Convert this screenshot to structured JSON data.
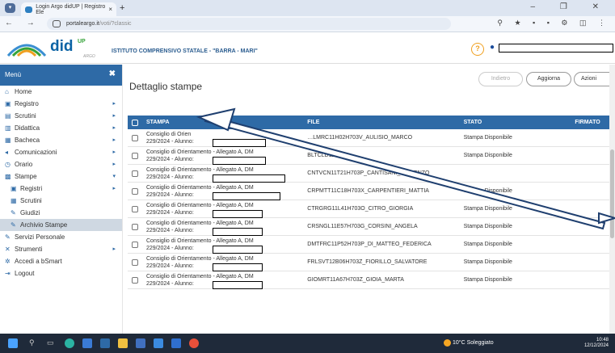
{
  "browser": {
    "tab_title": "Login Argo didUP | Registro Ele",
    "new_tab": "+",
    "url_host": "portaleargo.it",
    "url_path": "/voti/?classic",
    "window_controls": "– ❐ ✕"
  },
  "header": {
    "brand": "did",
    "brand_sup": "UP",
    "brand_sub": "ARGO",
    "school": "ISTITUTO COMPRENSIVO STATALE - \"BARRA - MARI\"",
    "help": "?"
  },
  "sidebar": {
    "title": "Menù",
    "close": "✖",
    "items": [
      {
        "label": "Home",
        "icon": "home-icon",
        "glyph": "⌂",
        "arrow": "",
        "sub": false,
        "active": false
      },
      {
        "label": "Registro",
        "icon": "calendar-icon",
        "glyph": "▣",
        "arrow": "▸",
        "sub": false,
        "active": false
      },
      {
        "label": "Scrutini",
        "icon": "document-icon",
        "glyph": "▤",
        "arrow": "▸",
        "sub": false,
        "active": false
      },
      {
        "label": "Didattica",
        "icon": "book-icon",
        "glyph": "▥",
        "arrow": "▸",
        "sub": false,
        "active": false
      },
      {
        "label": "Bacheca",
        "icon": "board-icon",
        "glyph": "▦",
        "arrow": "▸",
        "sub": false,
        "active": false
      },
      {
        "label": "Comunicazioni",
        "icon": "megaphone-icon",
        "glyph": "◂",
        "arrow": "▸",
        "sub": false,
        "active": false
      },
      {
        "label": "Orario",
        "icon": "clock-icon",
        "glyph": "◷",
        "arrow": "▸",
        "sub": false,
        "active": false
      },
      {
        "label": "Stampe",
        "icon": "printer-icon",
        "glyph": "▩",
        "arrow": "▾",
        "sub": false,
        "active": false
      },
      {
        "label": "Registri",
        "icon": "calendar-icon",
        "glyph": "▣",
        "arrow": "▸",
        "sub": true,
        "active": false
      },
      {
        "label": "Scrutini",
        "icon": "grid-icon",
        "glyph": "▦",
        "arrow": "",
        "sub": true,
        "active": false
      },
      {
        "label": "Giudizi",
        "icon": "edit-icon",
        "glyph": "✎",
        "arrow": "",
        "sub": true,
        "active": false
      },
      {
        "label": "Archivio Stampe",
        "icon": "edit-icon",
        "glyph": "✎",
        "arrow": "",
        "sub": true,
        "active": true
      },
      {
        "label": "Servizi Personale",
        "icon": "edit-icon",
        "glyph": "✎",
        "arrow": "",
        "sub": false,
        "active": false
      },
      {
        "label": "Strumenti",
        "icon": "tools-icon",
        "glyph": "✕",
        "arrow": "▸",
        "sub": false,
        "active": false
      },
      {
        "label": "Accedi a bSmart",
        "icon": "star-icon",
        "glyph": "✲",
        "arrow": "",
        "sub": false,
        "active": false
      },
      {
        "label": "Logout",
        "icon": "logout-icon",
        "glyph": "⇥",
        "arrow": "",
        "sub": false,
        "active": false
      }
    ]
  },
  "main": {
    "title": "Dettaglio stampe",
    "buttons": {
      "back": "Indietro",
      "refresh": "Aggiorna",
      "actions": "Azioni"
    },
    "columns": {
      "stampa": "STAMPA",
      "file": "FILE",
      "stato": "STATO",
      "firmato": "FIRMATO"
    },
    "rows": [
      {
        "line1": "Consiglio di Orien",
        "line2": "229/2024 - Alunno:",
        "file": "…LMRC11H02H703V_AULISIO_MARCO",
        "stato": "Stampa Disponibile"
      },
      {
        "line1": "Consiglio di Orientamento - Allegato A, DM",
        "line2": "229/2024 - Alunno:",
        "file": "BLTCLD11…",
        "stato": "Stampa Disponibile"
      },
      {
        "line1": "Consiglio di Orientamento - Allegato A, DM",
        "line2": "229/2024 - Alunno:",
        "file": "CNTVCN11T21H703P_CANTISANI_VINCENZO",
        "stato": ""
      },
      {
        "line1": "Consiglio di Orientamento - Allegato A, DM",
        "line2": "229/2024 - Alunno:",
        "file": "CRPMTT11C18H703X_CARPENTIERI_MATTIA",
        "stato": "Stampa Disponibile"
      },
      {
        "line1": "Consiglio di Orientamento - Allegato A, DM",
        "line2": "229/2024 - Alunno:",
        "file": "CTRGRG11L41H703O_CITRO_GIORGIA",
        "stato": "Stampa Disponibile"
      },
      {
        "line1": "Consiglio di Orientamento - Allegato A, DM",
        "line2": "229/2024 - Alunno:",
        "file": "CRSNGL11E57H703G_CORSINI_ANGELA",
        "stato": "Stampa Disponibile"
      },
      {
        "line1": "Consiglio di Orientamento - Allegato A, DM",
        "line2": "229/2024 - Alunno:",
        "file": "DMTFRC11P52H703P_DI_MATTEO_FEDERICA",
        "stato": "Stampa Disponibile"
      },
      {
        "line1": "Consiglio di Orientamento - Allegato A, DM",
        "line2": "229/2024 - Alunno:",
        "file": "FRLSVT12B06H703Z_FIORILLO_SALVATORE",
        "stato": "Stampa Disponibile"
      },
      {
        "line1": "Consiglio di Orientamento - Allegato A, DM",
        "line2": "229/2024 - Alunno:",
        "file": "GIOMRT11A67H703Z_GIOIA_MARTA",
        "stato": "Stampa Disponibile"
      }
    ]
  },
  "taskbar": {
    "weather": "10°C Soleggiato",
    "time": "10:48",
    "date": "12/12/2024"
  },
  "colors": {
    "accent": "#2e6aa6",
    "active_item": "#cfd8e2",
    "taskbar": "#1f2a3a"
  }
}
